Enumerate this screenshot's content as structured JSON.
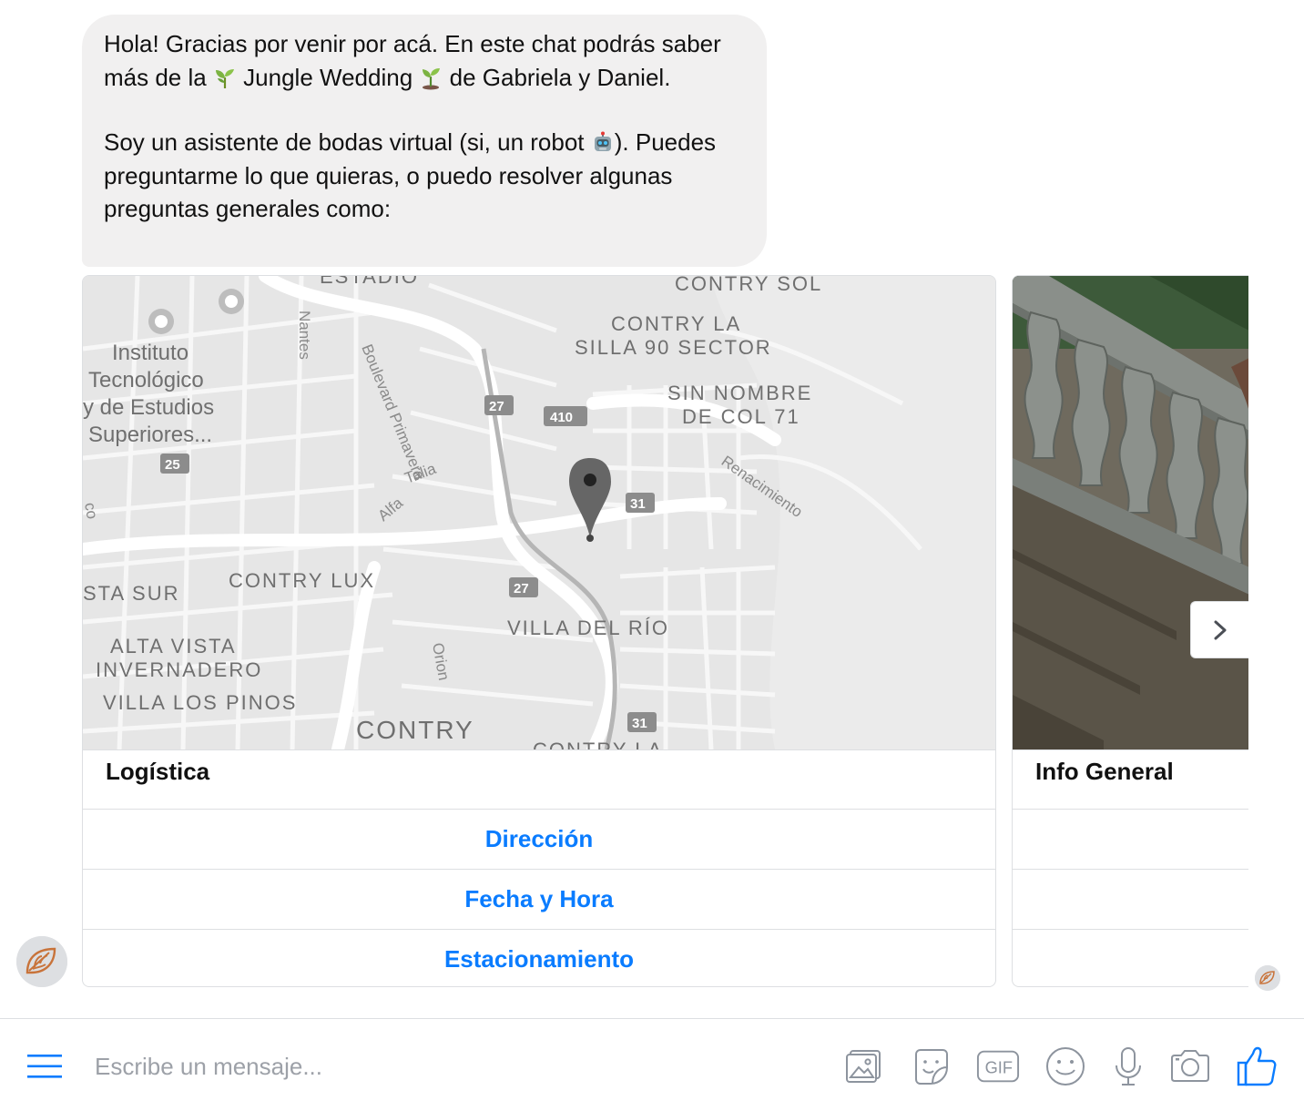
{
  "message": {
    "line1_part1": "Hola! Gracias por venir por acá. En este chat podrás saber más de la ",
    "event_name": " Jungle Wedding ",
    "line1_part2": " de Gabriela y Daniel.",
    "line2_part1": "Soy un asistente de bodas virtual (si, un robot ",
    "line2_part2": "). Puedes preguntarme lo que quieras, o puedo resolver algunas preguntas generales como:",
    "emojis": [
      "seedling-icon",
      "seedling-icon",
      "robot-face-icon"
    ]
  },
  "cards": [
    {
      "title": "Logística",
      "image": "map-preview",
      "buttons": [
        "Dirección",
        "Fecha y Hora",
        "Estacionamiento"
      ]
    },
    {
      "title": "Info General",
      "image": "stone-staircase-photo",
      "buttons": [
        "",
        "",
        ""
      ]
    }
  ],
  "map": {
    "labels": {
      "instituto": "Instituto",
      "tecnologico": "Tecnológico",
      "estudios": "y de Estudios",
      "superiores": "Superiores...",
      "estadio": "ESTADIO",
      "contry_sol": "CONTRY SOL",
      "contry_la": "CONTRY LA",
      "silla": "SILLA 90 SECTOR",
      "sin_nombre": "SIN NOMBRE",
      "de_col": "DE COL 71",
      "renacimiento": "Renacimiento",
      "nantes": "Nantes",
      "boulevard": "Boulevard Primavera",
      "talia": "Talia",
      "alfa": "Alfa",
      "co": "co",
      "sta_sur": "STA SUR",
      "contry_lux": "CONTRY LUX",
      "villa_del_rio": "VILLA DEL RÍO",
      "alta_vista": "ALTA VISTA",
      "invernadero": "INVERNADERO",
      "villa_los_pinos": "VILLA LOS PINOS",
      "orion": "Orion",
      "contry": "CONTRY",
      "contry_la_bottom": "CONTRY LA"
    },
    "shields": [
      "27",
      "410",
      "25",
      "31",
      "27",
      "31"
    ]
  },
  "composer": {
    "placeholder": "Escribe un mensaje...",
    "tools": [
      "image-icon",
      "sticker-icon",
      "gif-icon",
      "emoji-icon",
      "microphone-icon",
      "camera-icon",
      "like-icon"
    ],
    "gif_label": "GIF"
  },
  "colors": {
    "accent": "#0a7cff",
    "bubble": "#f1f0f0",
    "border": "#dddfe2"
  }
}
